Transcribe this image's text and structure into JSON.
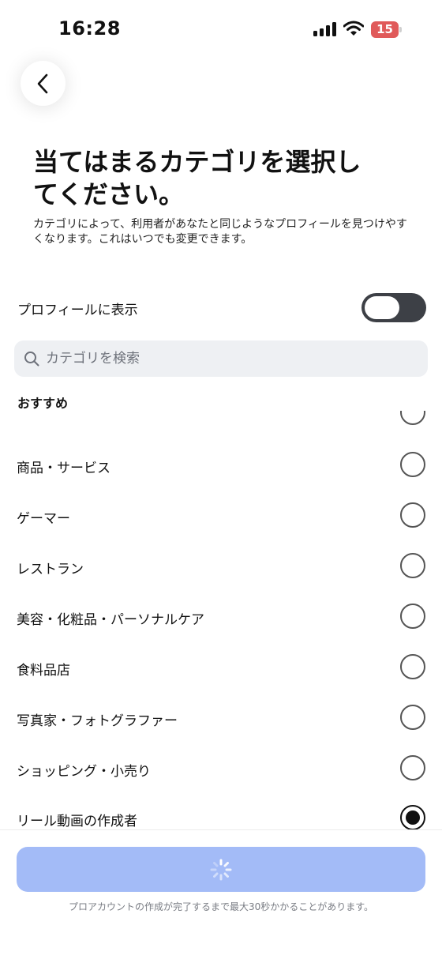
{
  "status_bar": {
    "time": "16:28",
    "battery": "15"
  },
  "header": {
    "back_icon": "chevron-left-icon",
    "title": "当てはまるカテゴリを選択してください。",
    "description": "カテゴリによって、利用者があなたと同じようなプロフィールを見つけやすくなります。これはいつでも変更できます。"
  },
  "profile_toggle": {
    "label": "プロフィールに表示",
    "enabled": false
  },
  "search": {
    "placeholder": "カテゴリを検索",
    "value": ""
  },
  "section": {
    "label": "おすすめ"
  },
  "categories": [
    {
      "label": "商品・サービス",
      "selected": false
    },
    {
      "label": "ゲーマー",
      "selected": false
    },
    {
      "label": "レストラン",
      "selected": false
    },
    {
      "label": "美容・化粧品・パーソナルケア",
      "selected": false
    },
    {
      "label": "食料品店",
      "selected": false
    },
    {
      "label": "写真家・フォトグラファー",
      "selected": false
    },
    {
      "label": "ショッピング・小売り",
      "selected": false
    },
    {
      "label": "リール動画の作成者",
      "selected": true
    }
  ],
  "footer": {
    "button_state": "loading",
    "note": "プロアカウントの作成が完了するまで最大30秒かかることがあります。"
  },
  "colors": {
    "accent_button": "#a3bbf7",
    "toggle_off": "#3d4046",
    "search_bg": "#eef0f3",
    "battery_low": "#e05a5a"
  }
}
